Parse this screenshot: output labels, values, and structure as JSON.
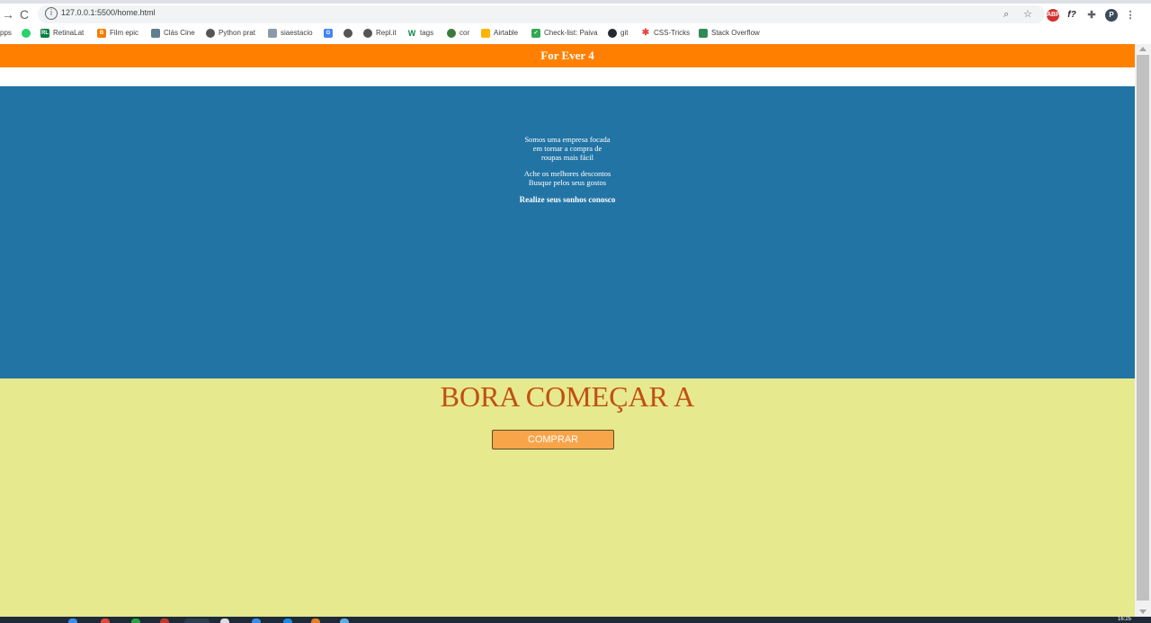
{
  "browser": {
    "url": "127.0.0.1:5500/home.html",
    "nav_back": "→",
    "nav_reload": "C",
    "info_glyph": "i",
    "profile_initial": "P",
    "abp_label": "ABP",
    "fx_label": "f?",
    "bookmarks": [
      {
        "label": "pps",
        "icon": "apps-icon",
        "color": "#ffffff"
      },
      {
        "label": "",
        "icon": "whatsapp-icon",
        "color": "#25d366"
      },
      {
        "label": "RetinaLat",
        "icon": "retinalat-icon",
        "color": "#0b8043",
        "glyph": "RL"
      },
      {
        "label": "Film epic",
        "icon": "blogger-icon",
        "color": "#f57d00",
        "glyph": "B"
      },
      {
        "label": "Clás Cine",
        "icon": "clascine-icon",
        "color": "#5f7f8f",
        "glyph": "CC"
      },
      {
        "label": "Python prat",
        "icon": "globe-icon",
        "color": "#555555"
      },
      {
        "label": "siaestacio",
        "icon": "cube-icon",
        "color": "#8a9aa8"
      },
      {
        "label": "",
        "icon": "translate-icon",
        "color": "#4285f4",
        "glyph": "G"
      },
      {
        "label": "",
        "icon": "globe-icon",
        "color": "#555555"
      },
      {
        "label": "Repl.it",
        "icon": "replit-icon",
        "color": "#555555"
      },
      {
        "label": "tags",
        "icon": "w-icon",
        "color": "#0a8a4a",
        "glyph": "W"
      },
      {
        "label": "cor",
        "icon": "cor-icon",
        "color": "#3a7a3a"
      },
      {
        "label": "Airtable",
        "icon": "airtable-icon",
        "color": "#fcb400"
      },
      {
        "label": "Check-list: Paiva",
        "icon": "check-icon",
        "color": "#34a853",
        "glyph": "✓"
      },
      {
        "label": "git",
        "icon": "github-icon",
        "color": "#24292e"
      },
      {
        "label": "CSS-Tricks",
        "icon": "asterisk-icon",
        "color": "#e8453c",
        "glyph": "✱"
      },
      {
        "label": "Stack Overflow",
        "icon": "stackoverflow-icon",
        "color": "#2e8b57"
      }
    ]
  },
  "page": {
    "brand": "For Ever 4",
    "hero": {
      "p1_lines": [
        "Somos uma empresa focada",
        "em tornar a compra de",
        "roupas mais fácil"
      ],
      "p2_lines": [
        "Ache os melhores descontos",
        "Busque pelos seus gostos"
      ],
      "tagline": "Realize seus sonhos conosco"
    },
    "cta": {
      "heading": "BORA COMEÇAR A",
      "button": "COMPRAR"
    },
    "colors": {
      "header": "#ff8000",
      "hero": "#2274a5",
      "cta_bg": "#e6e98d",
      "heading": "#c14f14",
      "button": "#f8a54a"
    }
  },
  "taskbar": {
    "clock": "16:25"
  }
}
